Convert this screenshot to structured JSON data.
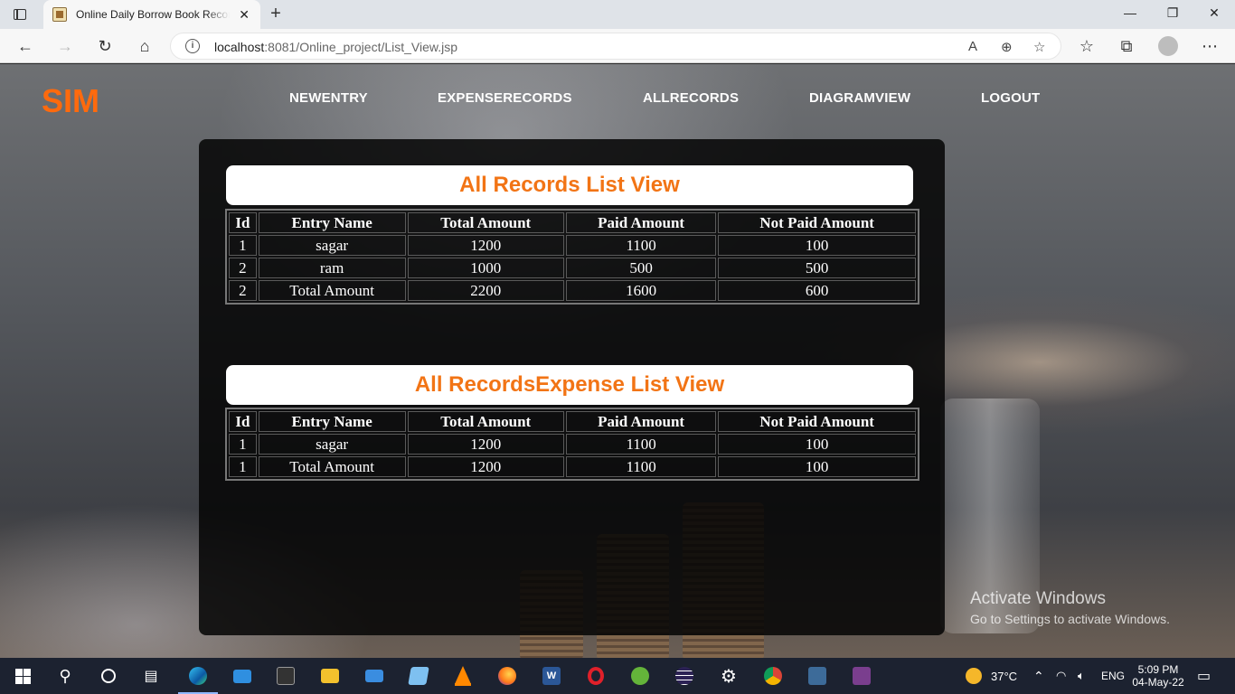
{
  "browser": {
    "tab_title": "Online Daily Borrow Book Record System",
    "new_tab": "+",
    "tab_close": "✕",
    "url_host": "localhost",
    "url_rest": ":8081/Online_project/List_View.jsp",
    "window_controls": {
      "minimize": "—",
      "restore": "❐",
      "close": "✕"
    }
  },
  "site": {
    "brand": "SIM",
    "nav": [
      {
        "label": "NEWENTRY"
      },
      {
        "label": "EXPENSERECORDS"
      },
      {
        "label": "ALLRECORDS"
      },
      {
        "label": "DIAGRAMVIEW"
      },
      {
        "label": "LOGOUT"
      }
    ]
  },
  "records": {
    "title": "All Records List View",
    "headers": [
      "Id",
      "Entry Name",
      "Total Amount",
      "Paid Amount",
      "Not Paid Amount"
    ],
    "rows": [
      [
        "1",
        "sagar",
        "1200",
        "1100",
        "100"
      ],
      [
        "2",
        "ram",
        "1000",
        "500",
        "500"
      ],
      [
        "2",
        "Total Amount",
        "2200",
        "1600",
        "600"
      ]
    ]
  },
  "expenses": {
    "title": "All RecordsExpense List View",
    "headers": [
      "Id",
      "Entry Name",
      "Total Amount",
      "Paid Amount",
      "Not Paid Amount"
    ],
    "rows": [
      [
        "1",
        "sagar",
        "1200",
        "1100",
        "100"
      ],
      [
        "1",
        "Total Amount",
        "1200",
        "1100",
        "100"
      ]
    ]
  },
  "watermark": {
    "line1": "Activate Windows",
    "line2": "Go to Settings to activate Windows."
  },
  "taskbar": {
    "weather": "37°C",
    "language": "ENG",
    "time": "5:09 PM",
    "date": "04-May-22"
  },
  "colors": {
    "brand": "#ff6a0d",
    "section_title": "#f27415",
    "taskbar": "#1c2230"
  }
}
